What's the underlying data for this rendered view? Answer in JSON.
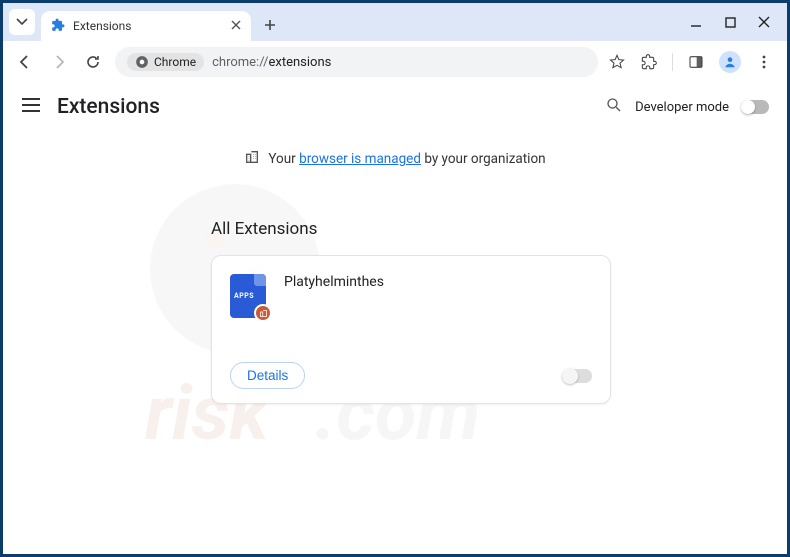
{
  "tab": {
    "title": "Extensions"
  },
  "address": {
    "chip": "Chrome",
    "url_scheme": "chrome://",
    "url_path": "extensions"
  },
  "page": {
    "title": "Extensions",
    "developer_mode_label": "Developer mode",
    "managed_prefix": "Your ",
    "managed_link": "browser is managed",
    "managed_suffix": " by your organization",
    "section_title": "All Extensions"
  },
  "extension": {
    "name": "Platyhelminthes",
    "icon_label": "APPS",
    "details_button": "Details"
  }
}
